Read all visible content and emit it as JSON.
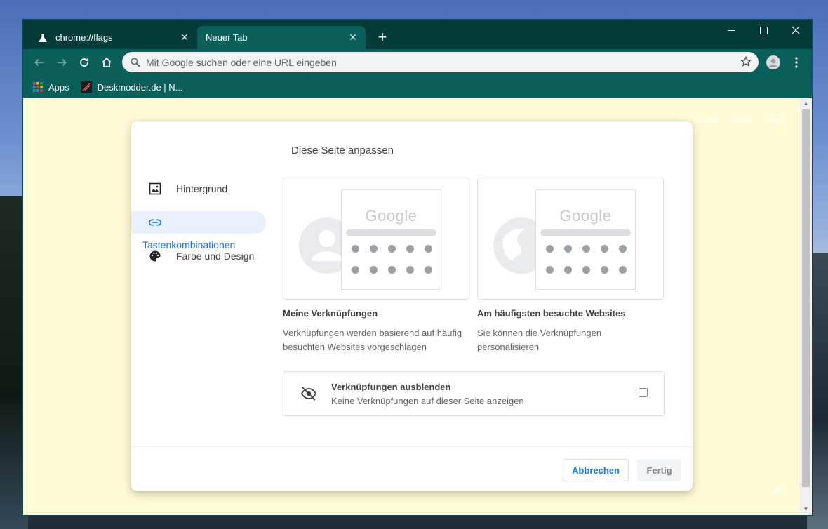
{
  "tabs": [
    {
      "label": "chrome://flags",
      "icon": "flask-icon"
    },
    {
      "label": "Neuer Tab",
      "icon": ""
    }
  ],
  "omnibox": {
    "placeholder": "Mit Google suchen oder eine URL eingeben"
  },
  "bookmarks": [
    {
      "label": "Apps",
      "icon": "apps-grid-icon"
    },
    {
      "label": "Deskmodder.de | N...",
      "icon": "deskmodder-favicon"
    }
  ],
  "ntp_links": {
    "gmail": "Gmail",
    "images": "Bilder"
  },
  "dialog": {
    "title": "Diese Seite anpassen",
    "menu": [
      {
        "label": "Hintergrund",
        "icon": "image-icon"
      },
      {
        "label": "Tastenkombinationen",
        "icon": "link-icon",
        "selected": true
      },
      {
        "label": "Farbe und Design",
        "icon": "palette-icon"
      }
    ],
    "options": [
      {
        "title": "Meine Verknüpfungen",
        "desc": "Verknüpfungen werden basierend auf häufig besuchten Websites vorgeschlagen",
        "logo": "Google"
      },
      {
        "title": "Am häufigsten besuchte Websites",
        "desc": "Sie können die Verknüpfungen personalisieren",
        "logo": "Google"
      }
    ],
    "hide": {
      "title": "Verknüpfungen ausblenden",
      "subtitle": "Keine Verknüpfungen auf dieser Seite anzeigen"
    },
    "cancel_label": "Abbrechen",
    "done_label": "Fertig"
  },
  "colors": {
    "frame": "#023b37",
    "toolbar": "#0b5f5b",
    "page_bg": "#fefbd6",
    "accent": "#1a73e8"
  }
}
